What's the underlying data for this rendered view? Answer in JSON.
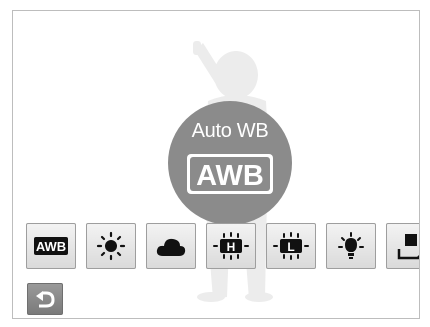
{
  "header": {
    "mode_label": "Auto WB"
  },
  "options": [
    {
      "name": "auto-wb-option",
      "icon": "awb-icon",
      "text": "AWB"
    },
    {
      "name": "daylight-option",
      "icon": "sun-icon"
    },
    {
      "name": "cloudy-option",
      "icon": "cloud-icon"
    },
    {
      "name": "fluorescent-h-option",
      "icon": "fluorescent-h-icon",
      "text": "H"
    },
    {
      "name": "fluorescent-l-option",
      "icon": "fluorescent-l-icon",
      "text": "L"
    },
    {
      "name": "tungsten-option",
      "icon": "bulb-icon"
    },
    {
      "name": "custom-set-option",
      "icon": "custom-set-icon"
    }
  ],
  "selected_glyph": "AWB",
  "nav": {
    "back_icon": "back-arrow-icon"
  },
  "colors": {
    "badge": "#8b8b8b",
    "glyph": "#111111",
    "frame": "#9e9e9e"
  }
}
